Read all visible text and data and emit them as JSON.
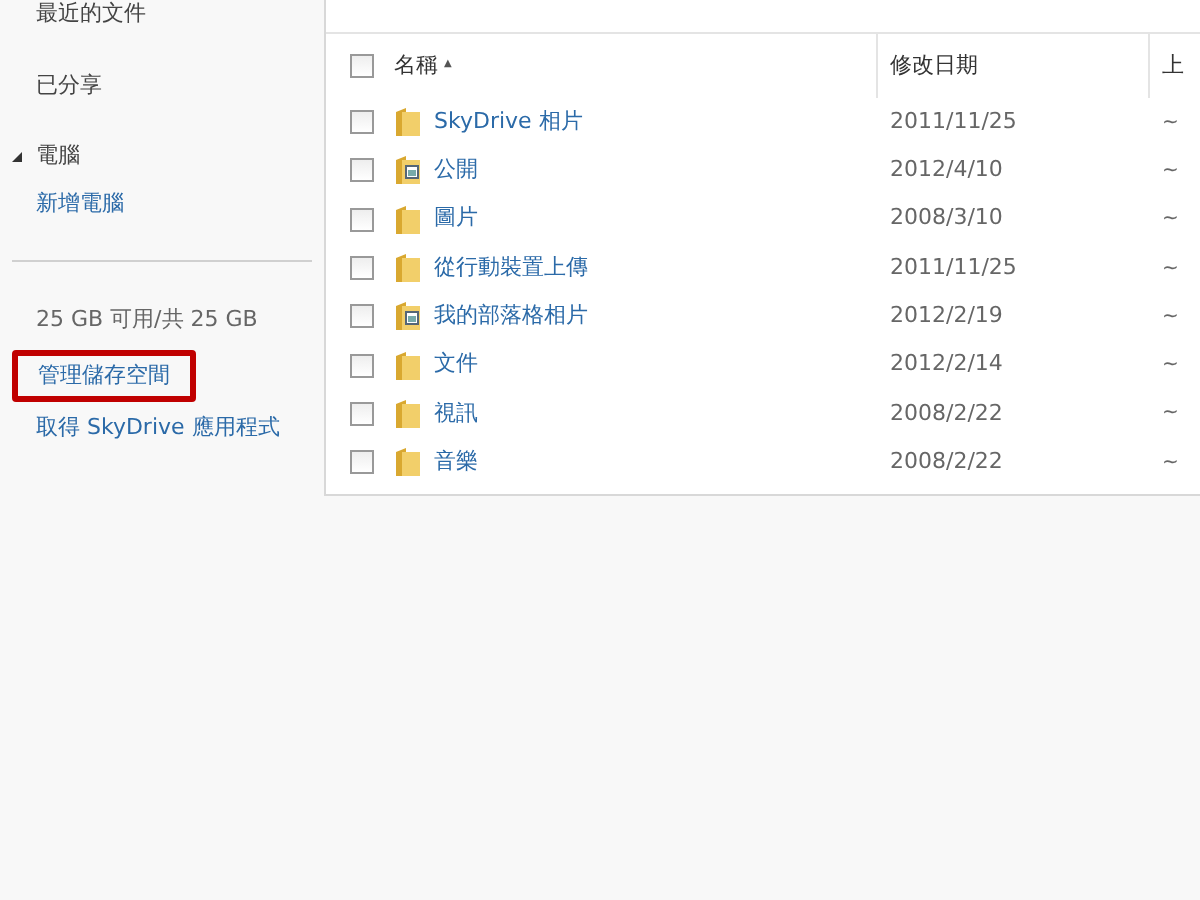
{
  "sidebar": {
    "items": [
      {
        "kind": "link",
        "label": "最近的文件"
      },
      {
        "kind": "link",
        "label": "已分享"
      },
      {
        "kind": "section",
        "label": "電腦",
        "expanded": true
      },
      {
        "kind": "action",
        "label": "新增電腦"
      }
    ],
    "storage": "25 GB 可用/共 25 GB",
    "links": [
      {
        "label": "管理儲存空間",
        "highlighted": true
      },
      {
        "label": "取得 SkyDrive 應用程式",
        "highlighted": false
      }
    ]
  },
  "table": {
    "select_all": {
      "checked": false
    },
    "columns": [
      {
        "label": "名稱",
        "sort_icon": "▲"
      },
      {
        "label": "修改日期"
      },
      {
        "label": "上"
      }
    ],
    "rows": [
      {
        "kind": "folder",
        "name": "SkyDrive 相片",
        "date": "2011/11/25",
        "column_3": "~",
        "checked": false
      },
      {
        "kind": "shared-folder",
        "name": "公開",
        "date": "2012/4/10",
        "column_3": "~",
        "checked": false
      },
      {
        "kind": "folder",
        "name": "圖片",
        "date": "2008/3/10",
        "column_3": "~",
        "checked": false
      },
      {
        "kind": "folder",
        "name": "從行動裝置上傳",
        "date": "2011/11/25",
        "column_3": "~",
        "checked": false
      },
      {
        "kind": "shared-folder",
        "name": "我的部落格相片",
        "date": "2012/2/19",
        "column_3": "~",
        "checked": false
      },
      {
        "kind": "folder",
        "name": "文件",
        "date": "2012/2/14",
        "column_3": "~",
        "checked": false
      },
      {
        "kind": "folder",
        "name": "視訊",
        "date": "2008/2/22",
        "column_3": "~",
        "checked": false
      },
      {
        "kind": "folder",
        "name": "音樂",
        "date": "2008/2/22",
        "column_3": "~",
        "checked": false
      }
    ]
  }
}
